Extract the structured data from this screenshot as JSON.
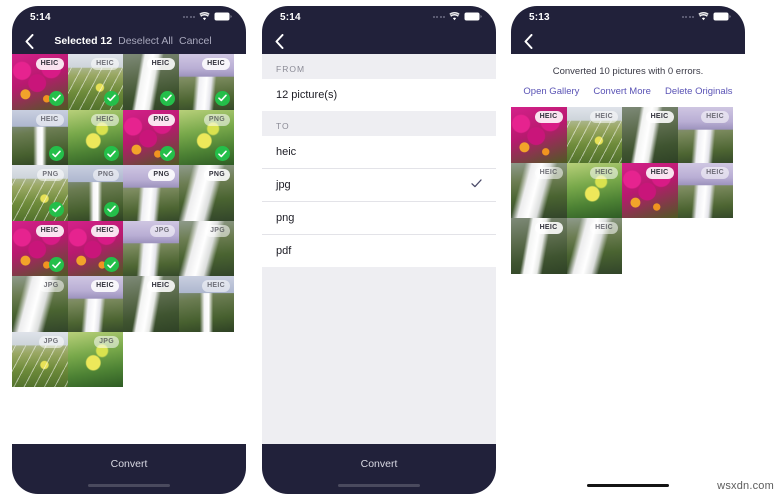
{
  "watermark": "wsxdn.com",
  "screens": [
    {
      "id": "select",
      "status": {
        "time": "5:14",
        "wifi_icon": "wifi-icon",
        "battery_icon": "battery-icon",
        "signal_icon": "signal-dots-icon"
      },
      "nav": {
        "back_icon": "back-chevron-icon",
        "title": "Selected 12",
        "deselect_label": "Deselect All",
        "cancel_label": "Cancel"
      },
      "grid": [
        {
          "scene": "flowers",
          "badge": "HEIC",
          "badge_dim": false,
          "checked": true
        },
        {
          "scene": "slope",
          "badge": "HEIC",
          "badge_dim": true,
          "checked": true
        },
        {
          "scene": "waterfall",
          "badge": "HEIC",
          "badge_dim": false,
          "checked": true
        },
        {
          "scene": "purplefall",
          "badge": "HEIC",
          "badge_dim": false,
          "checked": true
        },
        {
          "scene": "cliff",
          "badge": "HEIC",
          "badge_dim": true,
          "checked": true
        },
        {
          "scene": "greenleaf",
          "badge": "HEIC",
          "badge_dim": true,
          "checked": true
        },
        {
          "scene": "flowers",
          "badge": "PNG",
          "badge_dim": false,
          "checked": true
        },
        {
          "scene": "greenleaf",
          "badge": "PNG",
          "badge_dim": true,
          "checked": true
        },
        {
          "scene": "slope",
          "badge": "PNG",
          "badge_dim": true,
          "checked": true
        },
        {
          "scene": "cliff",
          "badge": "PNG",
          "badge_dim": true,
          "checked": true
        },
        {
          "scene": "purplefall",
          "badge": "PNG",
          "badge_dim": false,
          "checked": false
        },
        {
          "scene": "mossfall",
          "badge": "PNG",
          "badge_dim": false,
          "checked": false
        },
        {
          "scene": "flowers",
          "badge": "HEIC",
          "badge_dim": false,
          "checked": true
        },
        {
          "scene": "flowers",
          "badge": "HEIC",
          "badge_dim": false,
          "checked": true
        },
        {
          "scene": "purplefall",
          "badge": "JPG",
          "badge_dim": true,
          "checked": false
        },
        {
          "scene": "mossfall",
          "badge": "JPG",
          "badge_dim": true,
          "checked": false
        },
        {
          "scene": "mossfall",
          "badge": "JPG",
          "badge_dim": true,
          "checked": false
        },
        {
          "scene": "purplefall",
          "badge": "HEIC",
          "badge_dim": false,
          "checked": false
        },
        {
          "scene": "waterfall",
          "badge": "HEIC",
          "badge_dim": false,
          "checked": false
        },
        {
          "scene": "cliff",
          "badge": "HEIC",
          "badge_dim": true,
          "checked": false
        },
        {
          "scene": "slope",
          "badge": "JPG",
          "badge_dim": true,
          "checked": false
        },
        {
          "scene": "greenleaf",
          "badge": "JPG",
          "badge_dim": true,
          "checked": false
        }
      ],
      "bottom": {
        "label": "Convert",
        "style": "dark"
      }
    },
    {
      "id": "format",
      "status": {
        "time": "5:14",
        "wifi_icon": "wifi-icon",
        "battery_icon": "battery-icon",
        "signal_icon": "signal-dots-icon"
      },
      "nav": {
        "back_icon": "back-chevron-icon"
      },
      "from": {
        "header": "FROM",
        "value": "12 picture(s)"
      },
      "to": {
        "header": "TO",
        "options": [
          {
            "label": "heic",
            "selected": false
          },
          {
            "label": "jpg",
            "selected": true
          },
          {
            "label": "png",
            "selected": false
          },
          {
            "label": "pdf",
            "selected": false
          }
        ]
      },
      "bottom": {
        "label": "Convert",
        "style": "dark"
      }
    },
    {
      "id": "result",
      "status": {
        "time": "5:13",
        "wifi_icon": "wifi-icon",
        "battery_icon": "battery-icon",
        "signal_icon": "signal-dots-icon"
      },
      "nav": {
        "back_icon": "back-chevron-icon"
      },
      "result": {
        "message": "Converted 10 pictures with 0 errors.",
        "links": [
          "Open Gallery",
          "Convert More",
          "Delete Originals"
        ]
      },
      "grid": [
        {
          "scene": "flowers",
          "badge": "HEIC",
          "badge_dim": false,
          "checked": false
        },
        {
          "scene": "slope",
          "badge": "HEIC",
          "badge_dim": true,
          "checked": false
        },
        {
          "scene": "waterfall",
          "badge": "HEIC",
          "badge_dim": false,
          "checked": false
        },
        {
          "scene": "purplefall",
          "badge": "HEIC",
          "badge_dim": true,
          "checked": false
        },
        {
          "scene": "mossfall",
          "badge": "HEIC",
          "badge_dim": true,
          "checked": false
        },
        {
          "scene": "greenleaf",
          "badge": "HEIC",
          "badge_dim": true,
          "checked": false
        },
        {
          "scene": "flowers",
          "badge": "HEIC",
          "badge_dim": false,
          "checked": false
        },
        {
          "scene": "purplefall",
          "badge": "HEIC",
          "badge_dim": true,
          "checked": false
        },
        {
          "scene": "waterfall",
          "badge": "HEIC",
          "badge_dim": false,
          "checked": false
        },
        {
          "scene": "mossfall",
          "badge": "HEIC",
          "badge_dim": true,
          "checked": false
        }
      ],
      "bottom": {
        "label": "",
        "style": "light"
      }
    }
  ]
}
